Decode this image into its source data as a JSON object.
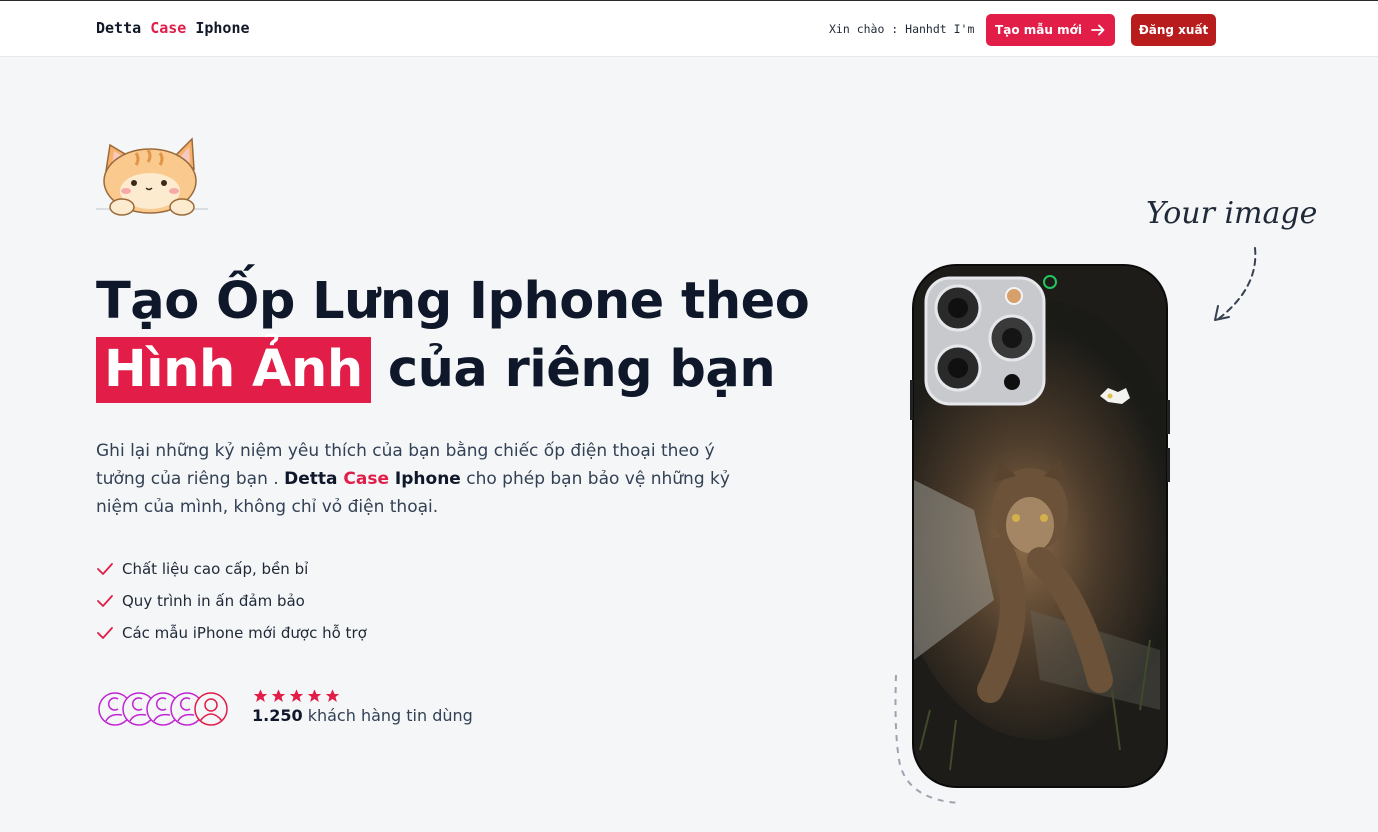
{
  "header": {
    "brand": {
      "part1": "Detta",
      "part2": "Case",
      "part3": "Iphone"
    },
    "greeting": "Xin chào : Hanhdt I'm",
    "create_button": "Tạo mẫu mới",
    "logout_button": "Đăng xuất"
  },
  "hero": {
    "title_line1": "Tạo Ốp Lưng Iphone theo",
    "title_highlight": "Hình Ảnh",
    "title_line2_rest": "của riêng bạn",
    "desc_part1": "Ghi lại những kỷ niệm yêu thích của bạn bằng chiếc ốp điện thoại theo ý tưởng của riêng bạn .",
    "desc_brand1": "Detta",
    "desc_brand2": "Case",
    "desc_brand3": "Iphone",
    "desc_part2": "cho phép bạn bảo vệ những kỷ niệm của mình, không chỉ vỏ điện thoại.",
    "features": [
      "Chất liệu cao cấp, bền bỉ",
      "Quy trình in ấn đảm bảo",
      "Các mẫu iPhone mới được hỗ trợ"
    ],
    "rating": {
      "stars": 5,
      "count": "1.250",
      "label": "khách hàng tin dùng"
    }
  },
  "phone": {
    "annotation": "Your image"
  },
  "colors": {
    "accent": "#e11d48",
    "logout": "#b91c1c",
    "text": "#0f172a"
  },
  "icons": [
    "arrow-right-icon",
    "check-icon",
    "star-icon",
    "user-avatar-icon",
    "cat-mascot-icon",
    "curved-arrow-icon"
  ]
}
